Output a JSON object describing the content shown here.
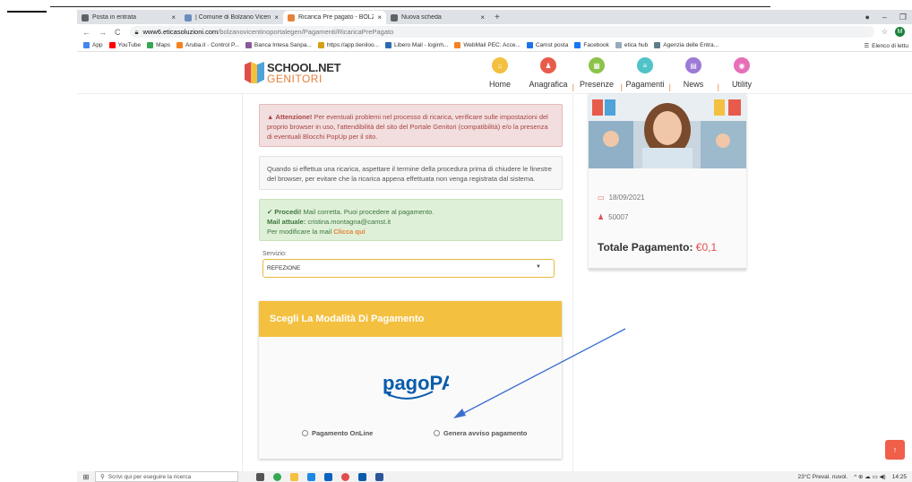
{
  "browser": {
    "tabs": [
      {
        "label": "Posta in entrata",
        "color": "#5f6368",
        "active": false
      },
      {
        "label": "| Comune di Bolzano Vicentino - I",
        "color": "#6c8ebf",
        "active": false
      },
      {
        "label": "Ricarica Pre pagato - BOLZANO",
        "color": "#e5823a",
        "active": true
      },
      {
        "label": "Nuova scheda",
        "color": "#5f6368",
        "active": false
      }
    ],
    "url_host": "www6.eticasoluzioni.com",
    "url_path": "/bolzanovicentinoportalegen/Pagamenti/RicaricaPrePagato",
    "profile_initial": "M",
    "bookmarks": [
      {
        "label": "App",
        "color": "#4285f4"
      },
      {
        "label": "YouTube",
        "color": "#ff0000"
      },
      {
        "label": "Maps",
        "color": "#34a853"
      },
      {
        "label": "Aruba.it - Control P...",
        "color": "#f58220"
      },
      {
        "label": "Banca Intesa Sanpa...",
        "color": "#8a5a9a"
      },
      {
        "label": "https://app.tieniloo...",
        "color": "#d4a017"
      },
      {
        "label": "Libero Mail - loginh...",
        "color": "#2b6cb0"
      },
      {
        "label": "WebMail PEC: Acce...",
        "color": "#f58220"
      },
      {
        "label": "Camst posta",
        "color": "#1a73e8"
      },
      {
        "label": "Facebook",
        "color": "#1877f2"
      },
      {
        "label": "etica hub",
        "color": "#9ab"
      },
      {
        "label": "Agenzia delle Entra...",
        "color": "#607d8b"
      }
    ],
    "reading_list": "Elenco di lettu"
  },
  "site": {
    "logo_line1": "SCHOOL.NET",
    "logo_line2": "GENITORI",
    "menu": [
      {
        "label": "Home",
        "color": "#f3c040",
        "icon": "home-icon"
      },
      {
        "label": "Anagrafica",
        "color": "#e85b4a",
        "icon": "user-icon"
      },
      {
        "label": "Presenze",
        "color": "#8bc34a",
        "icon": "calendar-icon"
      },
      {
        "label": "Pagamenti",
        "color": "#4fc3c8",
        "icon": "list-icon"
      },
      {
        "label": "News",
        "color": "#9c7ad6",
        "icon": "news-icon"
      },
      {
        "label": "Utility",
        "color": "#e66fb8",
        "icon": "eye-icon"
      }
    ]
  },
  "main": {
    "alert_red_bold": "Attenzione!",
    "alert_red_text": " Per eventuali problemi nel processo di ricarica, verificare sulle impostazioni del proprio browser in uso, l'attendibilità del sito del Portale Genitori (compatibilità) e/o la presenza di eventuali Blocchi PopUp per il sito.",
    "alert_grey_text": "Quando si effettua una ricarica, aspettare il termine della procedura prima di chiudere le finestre del browser, per evitare che la ricarica appena effettuata non venga registrata dal sistema.",
    "alert_green_bold": "Procedi!",
    "alert_green_text": " Mail corretta. Puoi procedere al pagamento.",
    "mail_label": "Mail attuale:",
    "mail_value": " cristina.montagna@camst.it",
    "change_mail_text": "Per modificare la mail ",
    "change_mail_link": "Clicca qui",
    "service_label": "Servizio:",
    "service_value": "REFEZIONE",
    "pay_header": "Scegli La Modalità Di Pagamento",
    "pagopa_text": "pagoPA",
    "option_online": "Pagamento OnLine",
    "option_avviso": "Genera avviso pagamento"
  },
  "side": {
    "date": "18/09/2021",
    "code": "50007",
    "total_label": "Totale Pagamento:",
    "total_value": " €0,1"
  },
  "taskbar": {
    "search_placeholder": "Scrivi qui per eseguire la ricerca",
    "weather": "23°C  Preval. nuvol.",
    "time": "14:25"
  }
}
